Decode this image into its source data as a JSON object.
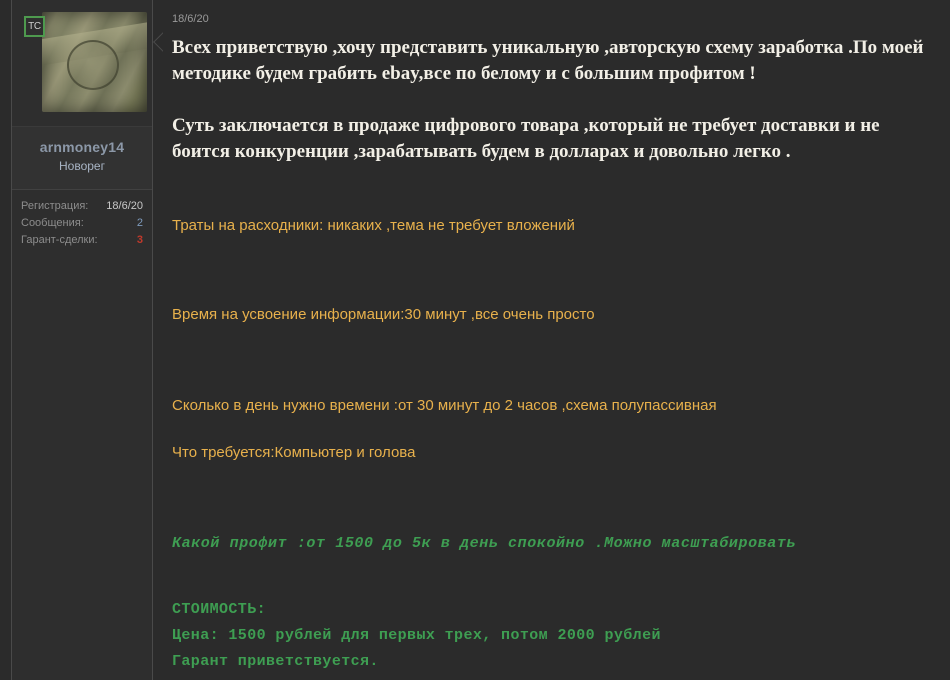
{
  "theme": {
    "page_bg": "#2b2b2b",
    "panel_bg": "#2e2e2e",
    "accent_green": "#3e9e52",
    "accent_tan": "#e8b14c",
    "text_light": "#f2efe6",
    "badge_border": "#4e9a4e",
    "username_color": "#8c98a8",
    "danger_red": "#c0392b"
  },
  "user_panel": {
    "thread_starter_badge": "TC",
    "avatar_alt": "dollar-bill-avatar",
    "username": "arnmoney14",
    "user_title": "Новорег",
    "stats": [
      {
        "label": "Регистрация:",
        "value": "18/6/20",
        "style": "plain"
      },
      {
        "label": "Сообщения:",
        "value": "2",
        "style": "blue"
      },
      {
        "label": "Гарант-сделки:",
        "value": "3",
        "style": "red"
      }
    ]
  },
  "post": {
    "date": "18/6/20",
    "intro": {
      "para1_line1": "Всех приветствую ,хочу представить уникальную ,авторскую схему заработка .По моей",
      "para1_line2": "методике будем грабить ebay,все по белому и с большим профитом !",
      "para2_line1": "Суть заключается в продаже цифрового товара ,который не требует доставки и не боится",
      "para2_line2": "конкуренции ,зарабатывать будем в долларах и довольно легко ."
    },
    "details": {
      "expenses": "Траты на расходники: никаких ,тема не требует вложений",
      "learning_time": "Время на усвоение информации:30 минут ,все очень просто",
      "daily_time": "Сколько в день нужно времени :от 30 минут до 2 часов ,схема полупассивная",
      "requirements": "Что требуется:Компьютер и голова"
    },
    "profit_line": "Какой профит :от 1500 до 5к в день спокойно .Можно масштабировать",
    "price_block": {
      "heading": "СТОИМОСТЬ:",
      "price": "Цена: 1500 рублей для первых трех, потом 2000 рублей",
      "guarantor": "Гарант приветствуется."
    }
  }
}
